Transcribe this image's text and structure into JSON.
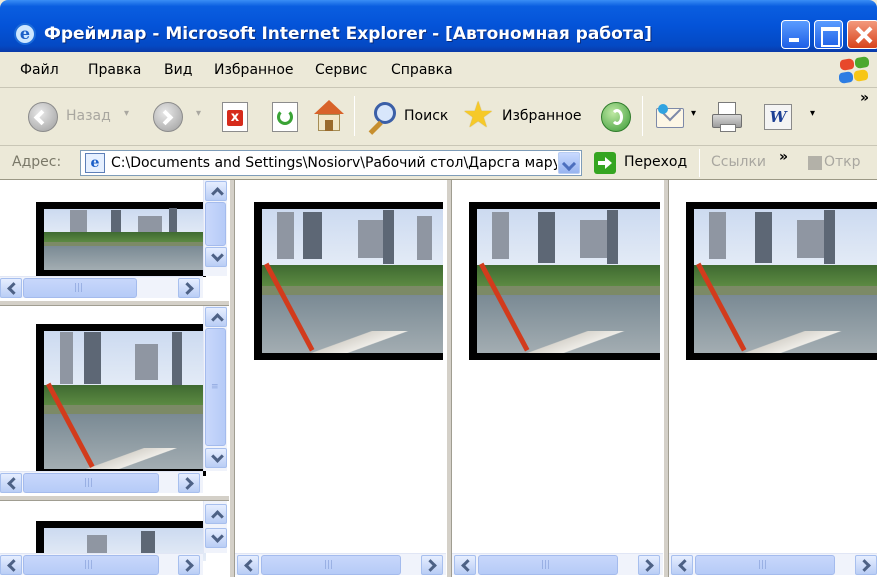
{
  "window": {
    "title": "Фреймлар - Microsoft Internet Explorer - [Автономная работа]"
  },
  "menu": [
    "Файл",
    "Правка",
    "Вид",
    "Избранное",
    "Сервис",
    "Справка"
  ],
  "toolbar": {
    "back_label": "Назад",
    "search_label": "Поиск",
    "favorites_label": "Избранное",
    "overflow": "»"
  },
  "address": {
    "label": "Адрес:",
    "value": "C:\\Documents and Settings\\Nosiorv\\Рабочий стол\\Дарсга мару",
    "go_label": "Переход",
    "links_label": "Ссылки",
    "links_overflow": "»",
    "open_label": "Откр"
  },
  "colors": {
    "title_bar": "#0453d8",
    "chrome": "#ece9d8",
    "frame_border": "#d4d0c8",
    "scrollbar": "#b6cbf7"
  },
  "icons": [
    "ie-icon",
    "minimize-icon",
    "maximize-icon",
    "close-icon",
    "windows-logo-icon",
    "back-icon",
    "forward-icon",
    "stop-icon",
    "refresh-icon",
    "home-icon",
    "search-icon",
    "favorites-star-icon",
    "media-icon",
    "mail-icon",
    "print-icon",
    "word-icon",
    "go-arrow-icon"
  ],
  "frames": [
    {
      "id": "left-top",
      "content": "photo"
    },
    {
      "id": "left-middle",
      "content": "photo"
    },
    {
      "id": "left-bottom",
      "content": "photo"
    },
    {
      "id": "main-1",
      "content": "photo"
    },
    {
      "id": "main-2",
      "content": "photo"
    },
    {
      "id": "main-3",
      "content": "photo"
    }
  ],
  "scrollbar_grip": "|||"
}
